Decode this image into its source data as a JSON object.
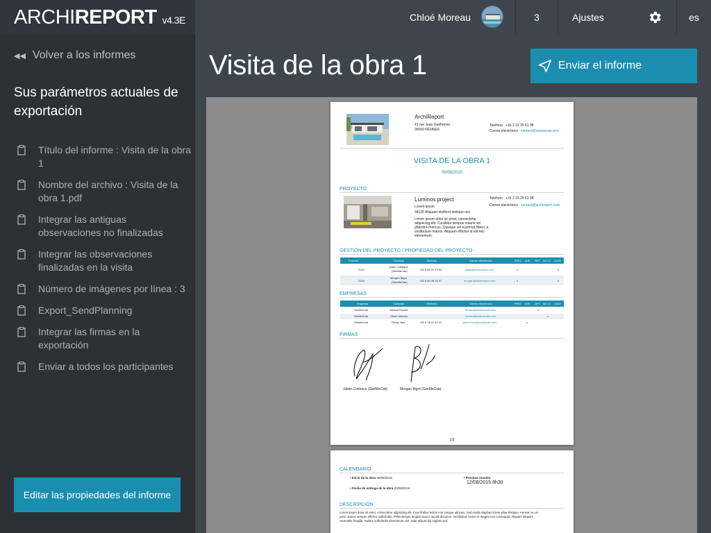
{
  "topbar": {
    "brand_light": "ARCHI",
    "brand_bold": "REPORT",
    "version": "v4.3E",
    "user_name": "Chloé Moreau",
    "count": "3",
    "settings_label": "Ajustes",
    "language": "es"
  },
  "sidebar": {
    "back_label": "Volver a los informes",
    "title": "Sus parámetros actuales de exportación",
    "params": [
      "Título del informe : Visita de la obra 1",
      "Nombre del archivo : Visita de la obra 1.pdf",
      "Integrar las antiguas observaciones no finalizadas",
      "Integrar las observaciones finalizadas en la visita",
      "Número de imágenes por línea : 3",
      "Export_SendPlanning",
      "Integrar las firmas en la exportación",
      "Enviar a todos los participantes"
    ],
    "edit_button": "Editar las propiedades del informe"
  },
  "main": {
    "title": "Visita de la obra 1",
    "send_button": "Enviar el informe"
  },
  "doc": {
    "company": "ArchiReport",
    "company_addr1": "41 rue Jean Guéhenno",
    "company_addr2": "35000 RENNES",
    "company_phone": "Teléfono : +33 2 23 25 61 98",
    "company_email_label": "Correo electrónico : ",
    "company_email": "contact@seemecab.com",
    "report_title": "VISITA DE LA OBRA 1",
    "report_date": "06/08/2015",
    "section_project": "PROYECTO",
    "project_name": "Luminos project",
    "project_line1": "Lorem ipsum",
    "project_line2": "34105 Aliquam eleifend tristique nisi",
    "project_desc1": "Lorem ipsum dolor sit amet, consectetur",
    "project_desc2": "adipiscing elit. Curabitur tempus mauris vel",
    "project_desc3": "pharetra rhoncus. Quisque vel euismod libero, a",
    "project_desc4": "vestibulum mauris. Aliquam efficitur id elit nec",
    "project_desc5": "elementum.",
    "project_phone": "Teléfono : +33 2 23 25 61 98",
    "project_email_label": "Correo electrónico : ",
    "project_email": "contact@archireport.com",
    "section_mgmt": "GESTIÓN DEL PROYECTO / PROPIEDAD DEL PROYECTO",
    "mgmt_headers": [
      "Función",
      "Contacto",
      "Teléfono",
      "Correo electrónico",
      "PRES",
      "AUS",
      "DIFF",
      "NO CV",
      "CONV"
    ],
    "mgmt_rows": [
      {
        "func": "OXO",
        "contact1": "Julien Cotteaux",
        "contact2": "(SeeMeCab)",
        "phone": "+33 6 60 07 79 92",
        "email": "julien@archireport.com",
        "m1": "x",
        "m2": "x"
      },
      {
        "func": "OXO",
        "contact1": "Morgan Bigot",
        "contact2": "(SeeMeCab)",
        "phone": "+33 6 60 35 41 07",
        "email": "morgan@archireport.com",
        "m1": "x",
        "m2": "x"
      }
    ],
    "section_companies": "EMPRESAS",
    "comp_headers": [
      "Empresa",
      "Contacto",
      "Teléfono",
      "Correo electrónico",
      "PRES",
      "AUS",
      "DIFF",
      "NO CV",
      "CONV"
    ],
    "comp_rows": [
      {
        "company": "SeeMeCab",
        "contact": "Arnaud Rouzel",
        "phone": "",
        "email": "arnaud@seemecab.com",
        "mark": "x"
      },
      {
        "company": "SeeMeCab",
        "contact": "Chloé Moreau",
        "phone": "",
        "email": "contact@seemecab.com",
        "mark": "x"
      },
      {
        "company": "SeeMeCab",
        "contact": "Simon Bos",
        "phone": "+33 6 78 47 87 01",
        "email": "simon.bos@seemecab.com",
        "mark": "x"
      }
    ],
    "section_signatures": "FIRMAS",
    "sig1_name": "Julien Cotteaux (SeeMeCab)",
    "sig2_name": "Morgan Bigot (SeeMeCab)",
    "page_number": "1/3",
    "section_calendar": "CALENDARIO",
    "cal_start_label": "Inicio de la obra",
    "cal_start_value": "06/08/2015",
    "cal_delivery_label": "Fecha de entrega de la obra",
    "cal_delivery_value": "03/08/2016",
    "cal_next_label": "Próxima reunión",
    "cal_next_value": "12/08/2015 8h30",
    "section_description": "DESCRIPCIÓN",
    "desc1": "Lorem ipsum dolor sit amet, consectetur adipiscing elit. Cras finibus lectus non congue ultricies. Sed mattis dapibus lorem vitae tristique. Aenean eu ex",
    "desc2": "justo. Donec semper efficitur sollicitudin. Pellentesque feugiat risus a iaculis dictumst. Vestibulum luctus et magna non consequat. Aliquam aliquam",
    "desc3": "venenatis fringilla. Nullam sollicitudin elementum nisl, vitae aliquet dui sagittis sed."
  }
}
